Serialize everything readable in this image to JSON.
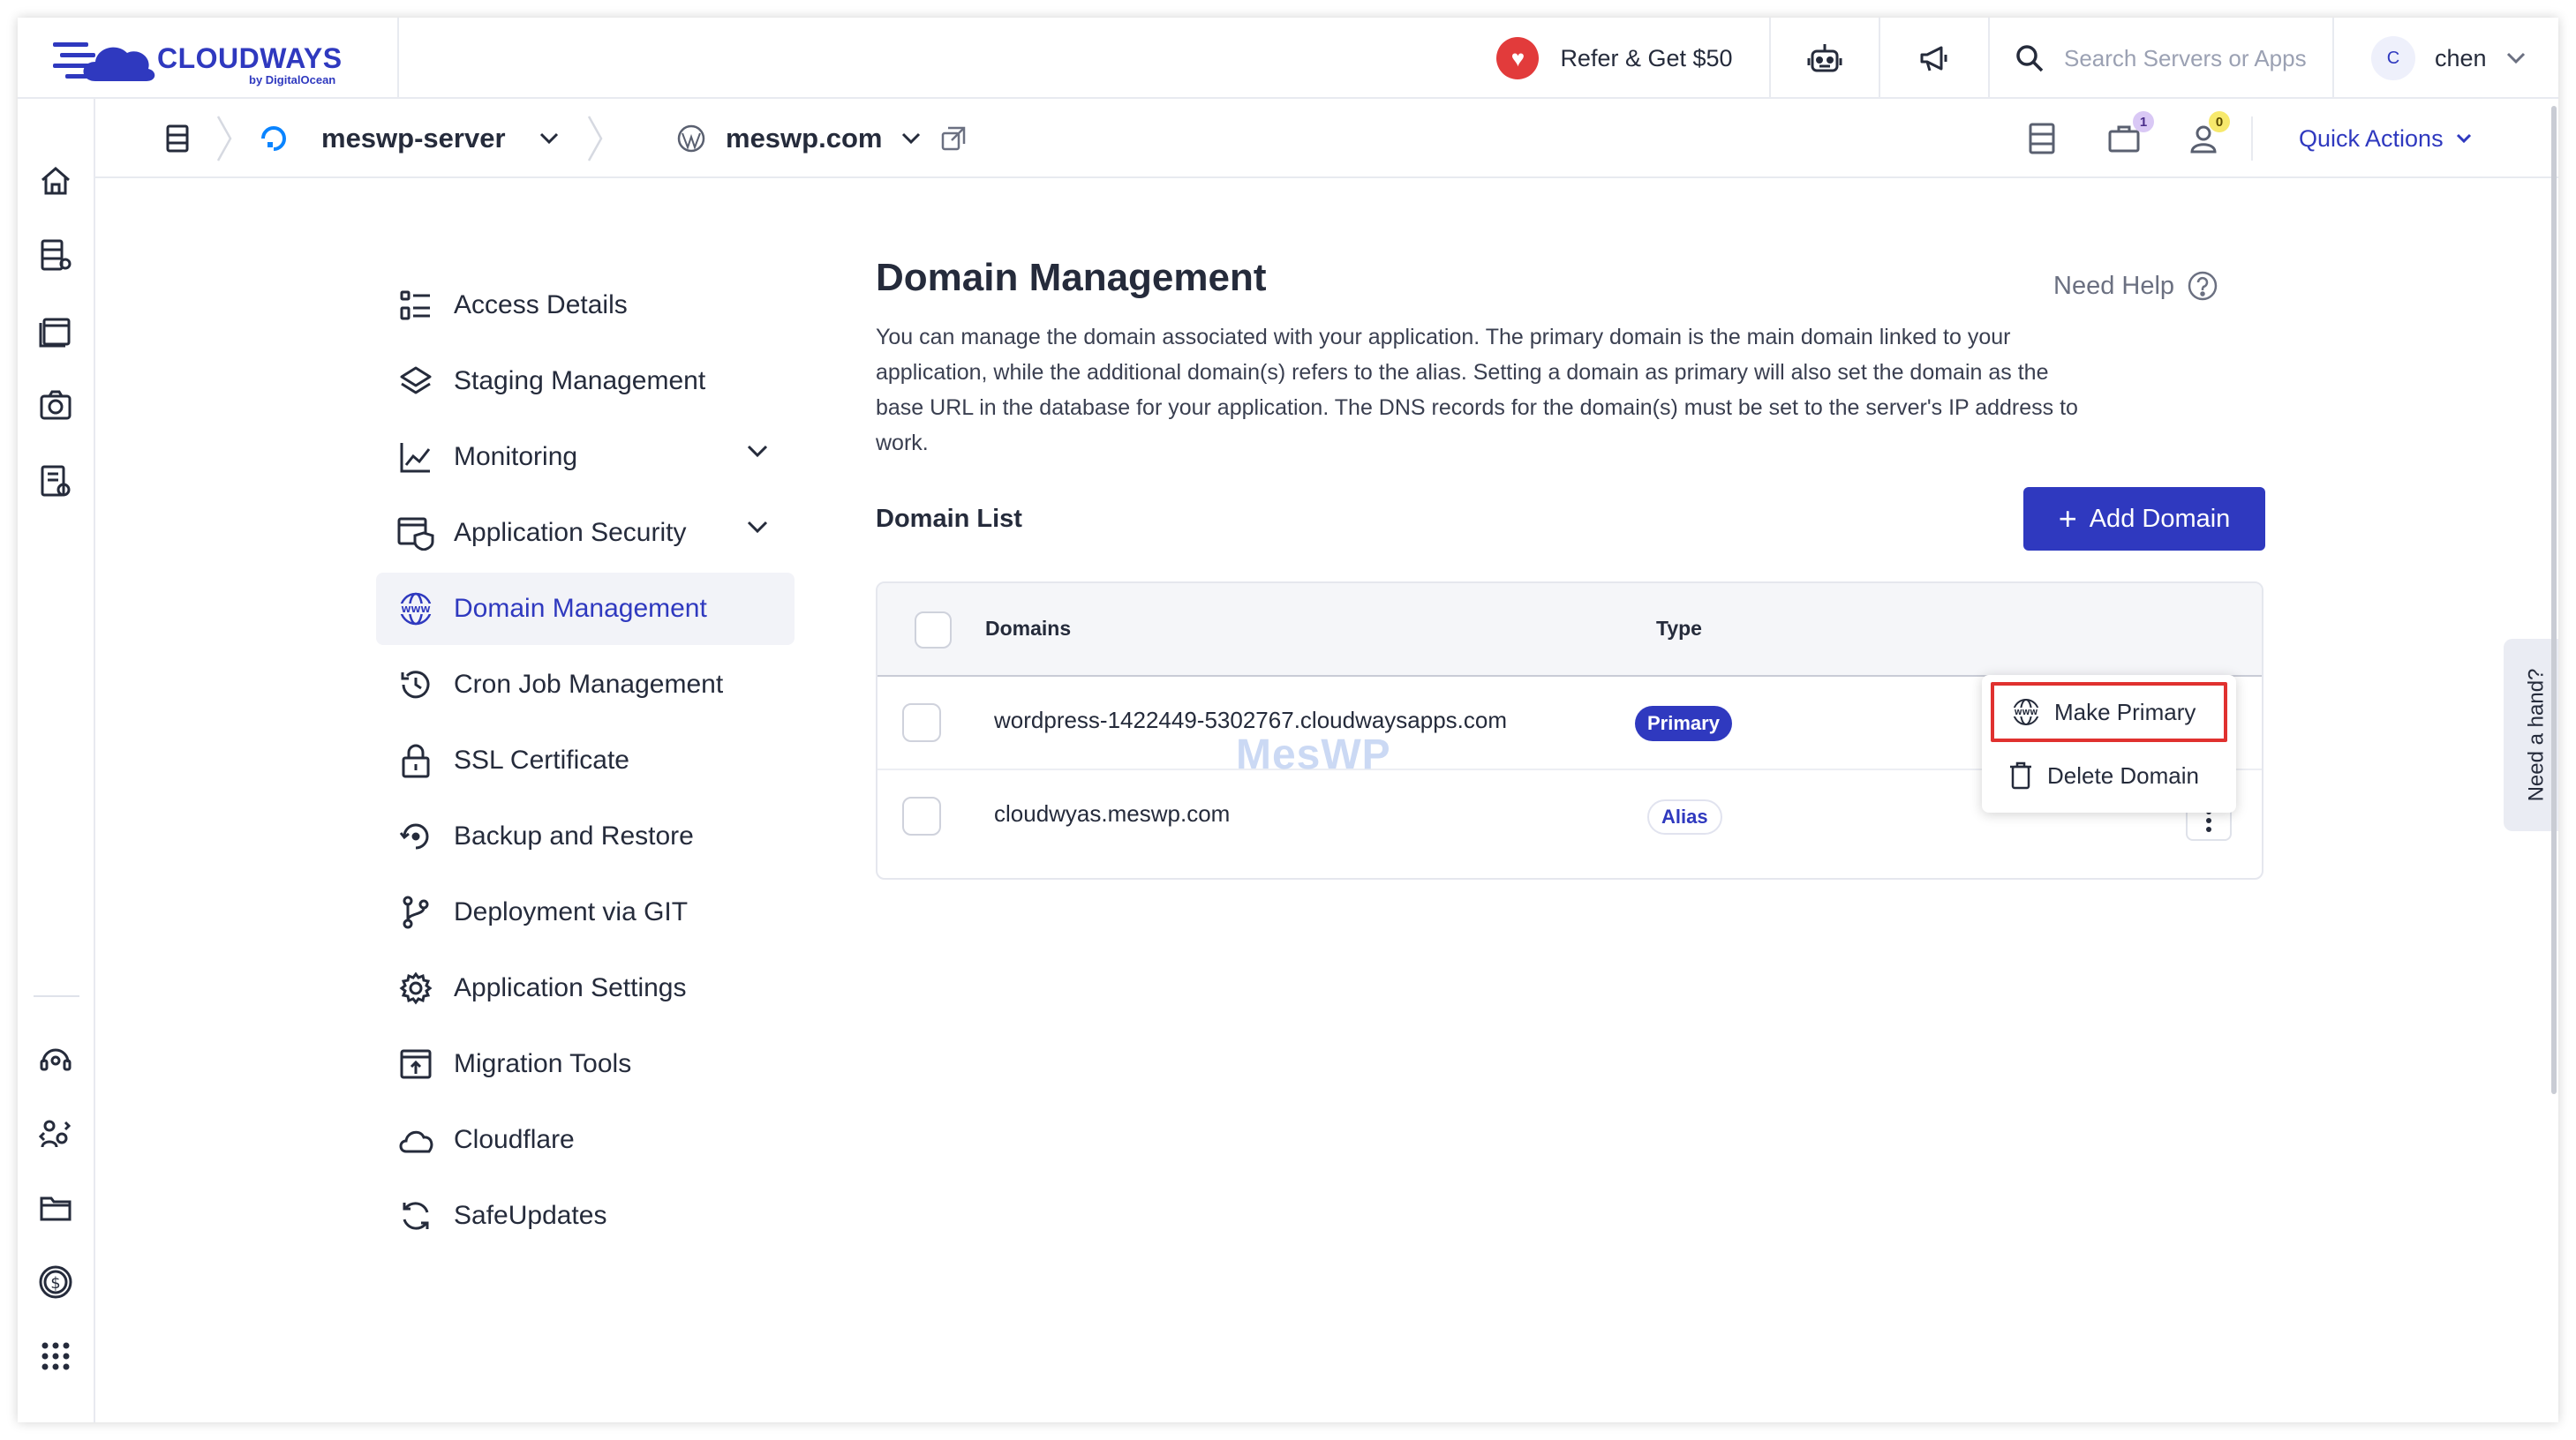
{
  "brand": {
    "name": "CLOUDWAYS",
    "sub": "by DigitalOcean",
    "color": "#2f39bf"
  },
  "topbar": {
    "refer_label": "Refer & Get $50",
    "search_placeholder": "Search Servers or Apps",
    "user_initial": "C",
    "user_name": "chen"
  },
  "subbar": {
    "server_name": "meswp-server",
    "app_name": "meswp.com",
    "notif_badge_1": "1",
    "notif_badge_2": "0",
    "quick_actions": "Quick Actions"
  },
  "menu": {
    "items": [
      {
        "label": "Access Details",
        "icon": "access-details-icon"
      },
      {
        "label": "Staging Management",
        "icon": "layers-icon"
      },
      {
        "label": "Monitoring",
        "icon": "chart-line-icon"
      },
      {
        "label": "Application Security",
        "icon": "shield-window-icon"
      },
      {
        "label": "Domain Management",
        "icon": "www-globe-icon"
      },
      {
        "label": "Cron Job Management",
        "icon": "history-clock-icon"
      },
      {
        "label": "SSL Certificate",
        "icon": "lock-icon"
      },
      {
        "label": "Backup and Restore",
        "icon": "backup-restore-icon"
      },
      {
        "label": "Deployment via GIT",
        "icon": "git-branch-icon"
      },
      {
        "label": "Application Settings",
        "icon": "gear-icon"
      },
      {
        "label": "Migration Tools",
        "icon": "migration-upload-icon"
      },
      {
        "label": "Cloudflare",
        "icon": "cloud-icon"
      },
      {
        "label": "SafeUpdates",
        "icon": "refresh-icon"
      }
    ],
    "active_index": 4
  },
  "main": {
    "title": "Domain Management",
    "help": "Need Help",
    "description": "You can manage the domain associated with your application. The primary domain is the main domain linked to your application, while the additional domain(s) refers to the alias. Setting a domain as primary will also set the domain as the base URL in the database for your application. The DNS records for the domain(s) must be set to the server's IP address to work.",
    "list_heading": "Domain List",
    "add_button": "Add Domain",
    "columns": {
      "domains": "Domains",
      "type": "Type"
    },
    "rows": [
      {
        "domain": "wordpress-1422449-5302767.cloudwaysapps.com",
        "type": "Primary"
      },
      {
        "domain": "cloudwyas.meswp.com",
        "type": "Alias"
      }
    ]
  },
  "dropdown": {
    "make_primary": "Make Primary",
    "delete_domain": "Delete Domain"
  },
  "watermark": "MesWP",
  "need_hand": "Need a hand?"
}
